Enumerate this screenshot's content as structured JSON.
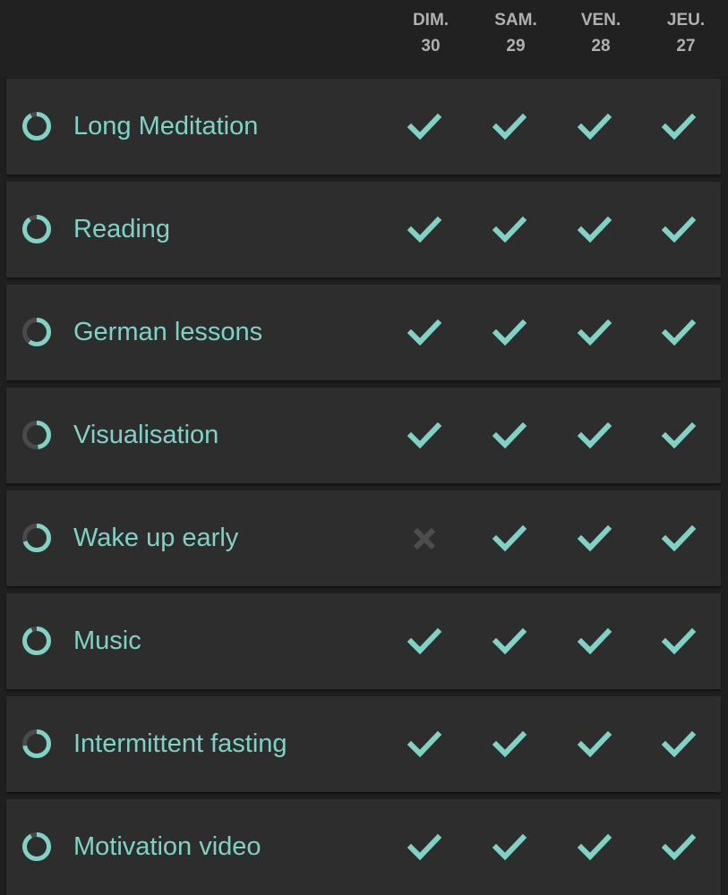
{
  "colors": {
    "accent": "#7fd3c6",
    "ring_track": "#4a4a4a",
    "missed": "#4d4d4d"
  },
  "days": [
    {
      "name": "DIM.",
      "num": "30"
    },
    {
      "name": "SAM.",
      "num": "29"
    },
    {
      "name": "VEN.",
      "num": "28"
    },
    {
      "name": "JEU.",
      "num": "27"
    }
  ],
  "habits": [
    {
      "name": "Long Meditation",
      "score": 0.92,
      "checks": [
        "done",
        "done",
        "done",
        "done"
      ]
    },
    {
      "name": "Reading",
      "score": 0.9,
      "checks": [
        "done",
        "done",
        "done",
        "done"
      ]
    },
    {
      "name": "German lessons",
      "score": 0.6,
      "checks": [
        "done",
        "done",
        "done",
        "done"
      ]
    },
    {
      "name": "Visualisation",
      "score": 0.48,
      "checks": [
        "done",
        "done",
        "done",
        "done"
      ]
    },
    {
      "name": "Wake up early",
      "score": 0.7,
      "checks": [
        "missed",
        "done",
        "done",
        "done"
      ]
    },
    {
      "name": "Music",
      "score": 0.93,
      "checks": [
        "done",
        "done",
        "done",
        "done"
      ]
    },
    {
      "name": "Intermittent fasting",
      "score": 0.72,
      "checks": [
        "done",
        "done",
        "done",
        "done"
      ]
    },
    {
      "name": "Motivation video",
      "score": 0.92,
      "checks": [
        "done",
        "done",
        "done",
        "done"
      ]
    }
  ]
}
